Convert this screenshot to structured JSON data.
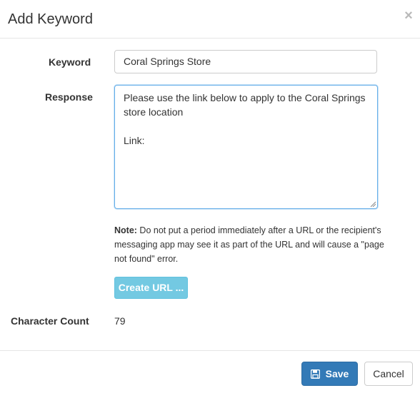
{
  "modal": {
    "title": "Add Keyword",
    "close_label": "×"
  },
  "form": {
    "keyword_label": "Keyword",
    "keyword_value": "Coral Springs Store",
    "response_label": "Response",
    "response_value": "Please use the link below to apply to the Coral Springs store location\n\nLink:",
    "note_prefix": "Note:",
    "note_text": " Do not put a period immediately after a URL or the recipient's messaging app may see it as part of the URL and will cause a \"page not found\" error.",
    "create_url_label": "Create URL ...",
    "char_count_label": "Character Count",
    "char_count_value": "79"
  },
  "footer": {
    "save_label": "Save",
    "cancel_label": "Cancel"
  },
  "icons": {
    "close": "close-icon",
    "save": "floppy-disk-icon"
  },
  "colors": {
    "primary": "#337ab7",
    "info": "#5bc0de",
    "focus_border": "#66afe9"
  }
}
